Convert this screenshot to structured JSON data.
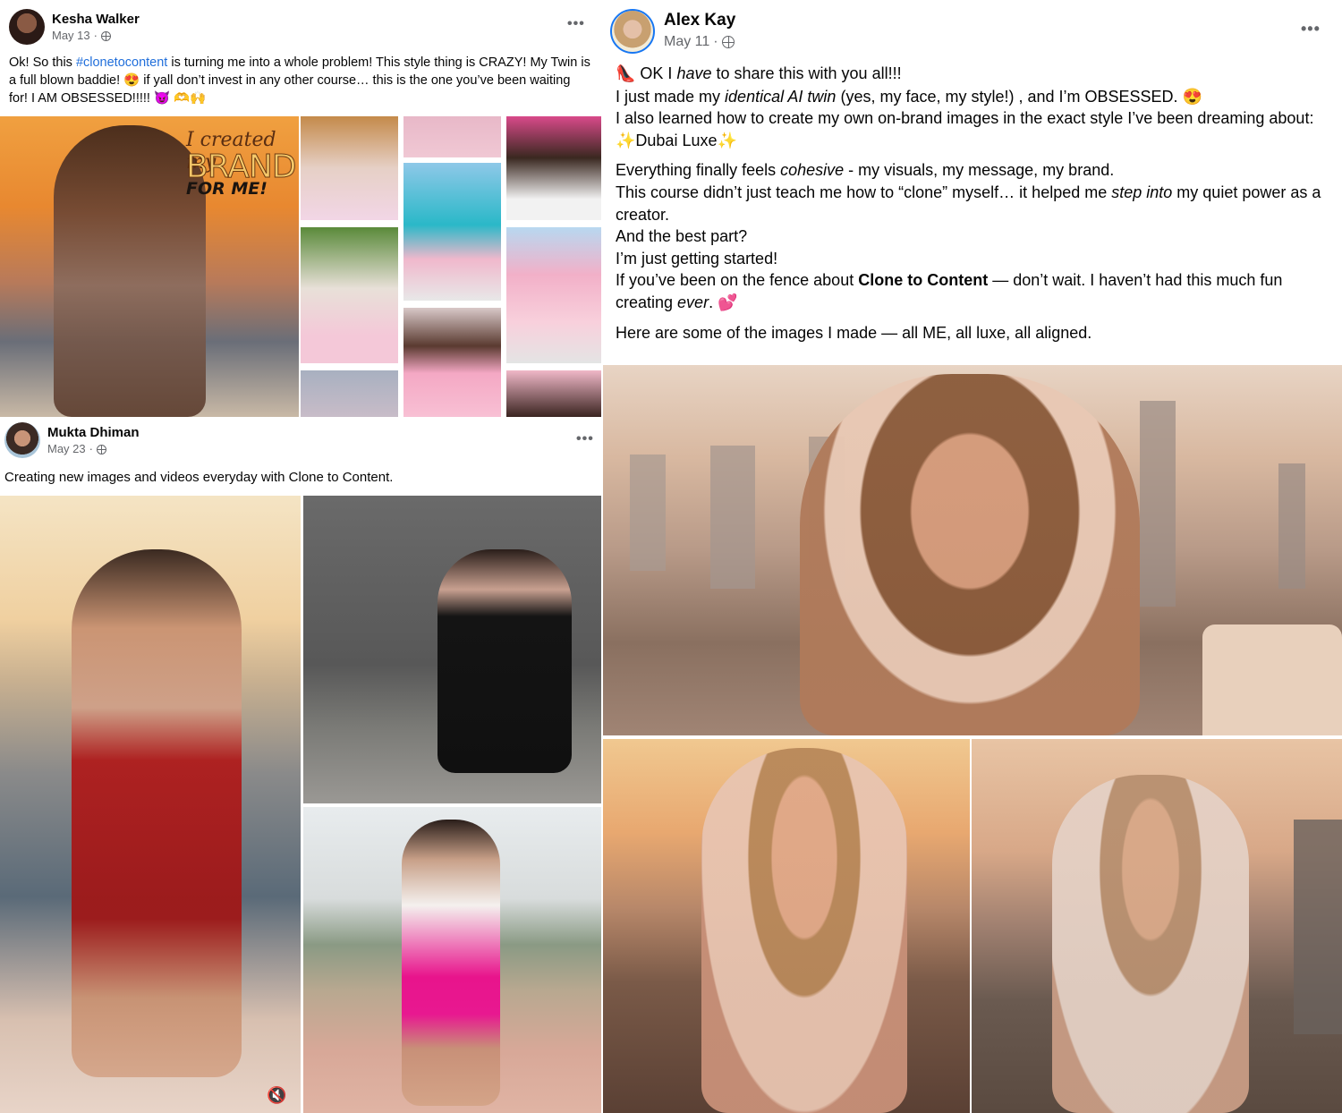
{
  "posts": {
    "kesha": {
      "author": "Kesha Walker",
      "date": "May 13",
      "text_pre": "Ok! So this ",
      "hashtag": "#clonetocontent",
      "text_post": " is turning me into a whole problem! This style thing is CRAZY! My Twin is a full blown baddie! 😍 if yall don’t invest in any other course… this is the one you’ve been waiting for! I AM OBSESSED!!!!! 😈 🫶🙌",
      "overlay_line1": "I created my",
      "overlay_line2": "BRAND",
      "overlay_line3": "FOR ME!"
    },
    "mukta": {
      "author": "Mukta Dhiman",
      "date": "May 23",
      "text": "Creating new images and videos everyday with Clone to Content."
    },
    "alex": {
      "author": "Alex Kay",
      "date": "May 11",
      "p1_emoji": "👠",
      "p1_pre": " OK I ",
      "p1_em": "have",
      "p1_post": " to share this with you all!!!",
      "p2_pre": "I just made my ",
      "p2_em": "identical AI twin",
      "p2_post": " (yes, my face, my style!) , and I’m OBSESSED. 😍",
      "p3": "I also learned how to create my own on-brand images in the exact style I’ve been dreaming about: ✨Dubai Luxe✨",
      "p4_pre": "Everything finally feels ",
      "p4_em": "cohesive",
      "p4_post": " - my visuals, my message, my brand.",
      "p5_pre": "This course didn’t just teach me how to “clone” myself… it helped me ",
      "p5_em": "step into",
      "p5_post": " my quiet power as a creator.",
      "p6": "And the best part?",
      "p7": "I’m just getting started!",
      "p8_pre": "If you’ve been on the fence about ",
      "p8_strong": "Clone to Content",
      "p8_mid": " — don’t wait. I haven’t had this much fun creating ",
      "p8_em": "ever",
      "p8_post": ". 💕",
      "p9": "Here are some of the images I made — all ME, all luxe, all aligned."
    }
  },
  "colors": {
    "link": "#216fdb",
    "meta_gray": "#65676b"
  },
  "icons": [
    "globe-icon",
    "more-options-icon",
    "volume-muted-icon"
  ]
}
